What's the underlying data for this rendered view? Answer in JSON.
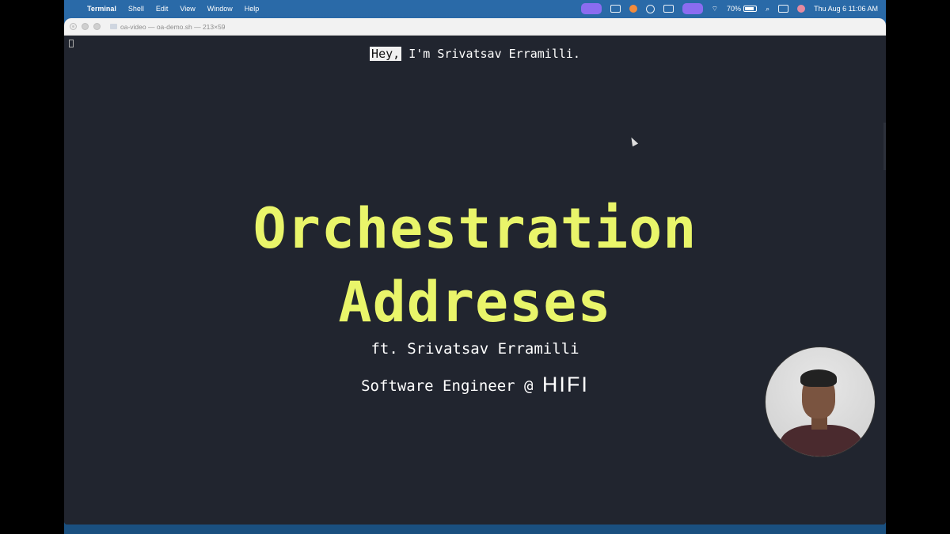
{
  "menubar": {
    "app_name": "Terminal",
    "menus": [
      "Shell",
      "Edit",
      "View",
      "Window",
      "Help"
    ],
    "battery": "70%",
    "datetime": "Thu Aug 6  11:06 AM"
  },
  "window": {
    "title": "oa-video — oa-demo.sh — 213×59"
  },
  "terminal": {
    "intro_highlight": "Hey,",
    "intro_rest": " I'm Srivatsav Erramilli.",
    "title_line1": "Orchestration",
    "title_line2": "Addreses",
    "subtitle1": "ft. Srivatsav Erramilli",
    "subtitle2": "Software Engineer @ ",
    "brand": "HIFI"
  },
  "colors": {
    "terminal_bg": "#21252f",
    "title_accent": "#e9f56a",
    "desktop_blue": "#2a6aa8"
  }
}
